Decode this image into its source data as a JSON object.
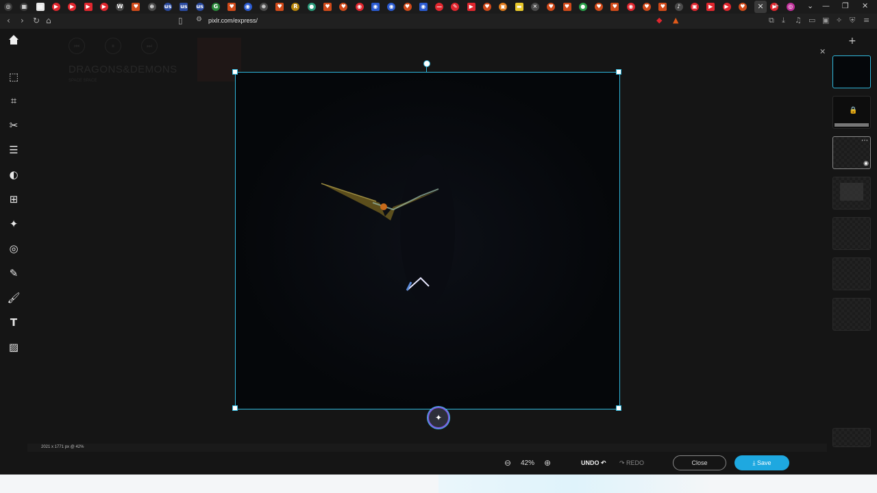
{
  "browser": {
    "url": "pixlr.com/express/",
    "tab_icons": [
      {
        "color": "#3a3a3a",
        "glyph": "◎"
      },
      {
        "color": "#3a3a3a",
        "glyph": "▦"
      },
      {
        "color": "#e8e8e8",
        "glyph": "▤"
      },
      {
        "color": "#e0262e",
        "glyph": "▶"
      },
      {
        "color": "#e0262e",
        "glyph": "▶"
      },
      {
        "color": "#e0262e",
        "glyph": "▶"
      },
      {
        "color": "#e0262e",
        "glyph": "▶"
      },
      {
        "color": "#4a4a4a",
        "glyph": "W"
      },
      {
        "color": "#d04a1a",
        "glyph": "♥"
      },
      {
        "color": "#4a4a4a",
        "glyph": "⊕"
      },
      {
        "color": "#2a4aa0",
        "glyph": "us"
      },
      {
        "color": "#2a4aa0",
        "glyph": "us"
      },
      {
        "color": "#2a4aa0",
        "glyph": "us"
      },
      {
        "color": "#2a8a3a",
        "glyph": "G"
      },
      {
        "color": "#d04a1a",
        "glyph": "♥"
      },
      {
        "color": "#2a5ad0",
        "glyph": "◉"
      },
      {
        "color": "#4a4a4a",
        "glyph": "⊕"
      },
      {
        "color": "#d04a1a",
        "glyph": "♥"
      },
      {
        "color": "#b8860b",
        "glyph": "R"
      },
      {
        "color": "#2a9a7a",
        "glyph": "●"
      },
      {
        "color": "#d04a1a",
        "glyph": "♥"
      },
      {
        "color": "#d04a1a",
        "glyph": "♥"
      },
      {
        "color": "#e0262e",
        "glyph": "◉"
      },
      {
        "color": "#2a5ad0",
        "glyph": "◉"
      },
      {
        "color": "#2a5ad0",
        "glyph": "◉"
      },
      {
        "color": "#d04a1a",
        "glyph": "♥"
      },
      {
        "color": "#2a5ad0",
        "glyph": "◉"
      },
      {
        "color": "#e0262e",
        "glyph": "—"
      },
      {
        "color": "#e0262e",
        "glyph": "✎"
      },
      {
        "color": "#e0262e",
        "glyph": "▶"
      },
      {
        "color": "#d04a1a",
        "glyph": "♥"
      },
      {
        "color": "#e07a1a",
        "glyph": "▣"
      },
      {
        "color": "#e8c82a",
        "glyph": "▬"
      },
      {
        "color": "#4a4a4a",
        "glyph": "✕"
      },
      {
        "color": "#d04a1a",
        "glyph": "♥"
      },
      {
        "color": "#d04a1a",
        "glyph": "♥"
      },
      {
        "color": "#2aa04a",
        "glyph": "●"
      },
      {
        "color": "#d04a1a",
        "glyph": "♥"
      },
      {
        "color": "#d04a1a",
        "glyph": "♥"
      },
      {
        "color": "#e0262e",
        "glyph": "◉"
      },
      {
        "color": "#d04a1a",
        "glyph": "♥"
      },
      {
        "color": "#d04a1a",
        "glyph": "♥"
      },
      {
        "color": "#4a4a4a",
        "glyph": "♪"
      },
      {
        "color": "#e0262e",
        "glyph": "▣"
      },
      {
        "color": "#e0262e",
        "glyph": "▶"
      },
      {
        "color": "#e0262e",
        "glyph": "▶"
      },
      {
        "color": "#d04a1a",
        "glyph": "♥"
      },
      {
        "color": "#e0262e",
        "glyph": "▶"
      },
      {
        "color": "#e0262e",
        "glyph": "▶"
      },
      {
        "color": "#c0309a",
        "glyph": "◎"
      }
    ]
  },
  "ghost_player": {
    "title": "DRAGONS&DEMONS",
    "subtitle": "SPACE SPACE"
  },
  "canvas": {
    "info": "2021 x 1771 px @ 42%"
  },
  "toolbar": {
    "zoom": "42%",
    "undo": "UNDO ↶",
    "redo": "↷ REDO",
    "close": "Close",
    "save": "Save"
  },
  "colors": {
    "accent": "#2fb7dc",
    "save": "#1ea8e0",
    "magic": "#7a5ce0"
  }
}
